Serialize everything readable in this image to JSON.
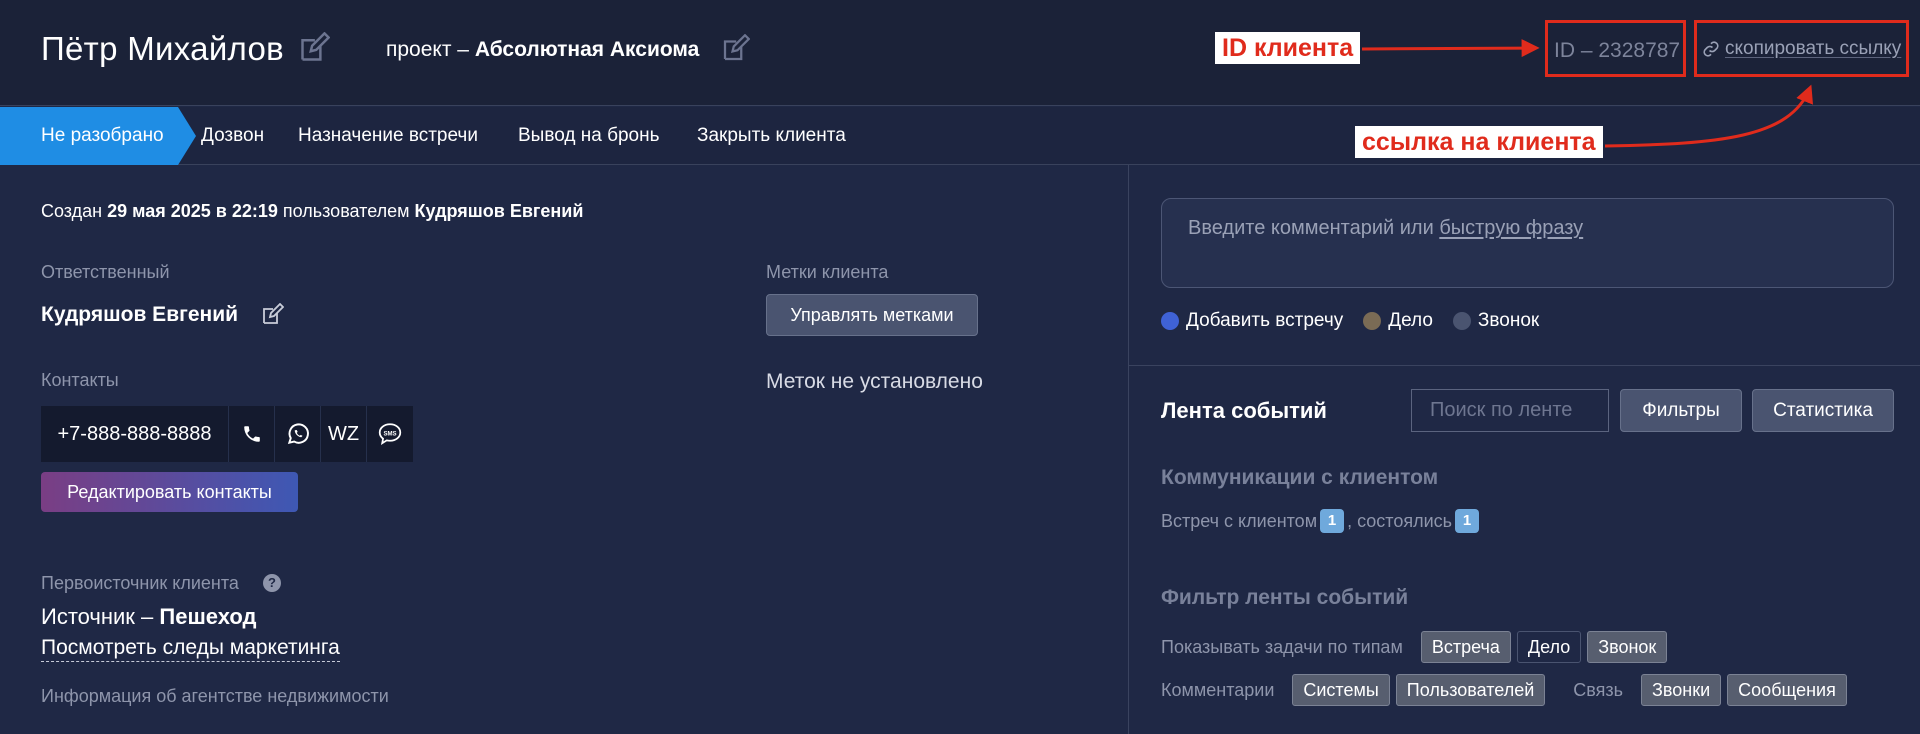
{
  "header": {
    "client_name": "Пётр Михайлов",
    "project_prefix": "проект – ",
    "project_name": "Абсолютная Аксиома",
    "client_id": "ID – 2328787",
    "copy_link": "скопировать ссылку"
  },
  "annotations": {
    "id_label": "ID клиента",
    "link_label": "ссылка на клиента",
    "color": "#e02b1c"
  },
  "tabs": {
    "active": "Не разобрано",
    "items": [
      "Дозвон",
      "Назначение встречи",
      "Вывод на бронь",
      "Закрыть клиента"
    ]
  },
  "left": {
    "created_prefix": "Создан ",
    "created_date": "29 мая 2025 в 22:19",
    "created_mid": " пользователем ",
    "created_user": "Кудряшов Евгений",
    "responsible_label": "Ответственный",
    "responsible_name": "Кудряшов Евгений",
    "contacts_label": "Контакты",
    "phone": "+7-888-888-8888",
    "wz": "WZ",
    "edit_contacts": "Редактировать контакты",
    "source_label": "Первоисточник клиента",
    "source_prefix": "Источник – ",
    "source_value": "Пешеход",
    "marketing_link": "Посмотреть следы маркетинга",
    "agency_info": "Информация об агентстве недвижимости",
    "tags_label": "Метки клиента",
    "manage_tags": "Управлять метками",
    "no_tags": "Меток не установлено"
  },
  "right": {
    "comment_placeholder": "Введите комментарий или ",
    "comment_phrase": "быструю фразу",
    "radios": [
      "Добавить встречу",
      "Дело",
      "Звонок"
    ],
    "radio_colors": [
      "#3f62d6",
      "#7a6b55",
      "#4a5470"
    ],
    "feed_title": "Лента событий",
    "feed_search_placeholder": "Поиск по ленте",
    "filters_btn": "Фильтры",
    "stats_btn": "Статистика",
    "comm_title": "Коммуникации с клиентом",
    "meets_prefix": "Встреч с клиентом",
    "meets_count": "1",
    "meets_mid": ", состоялись",
    "meets_done": "1",
    "filter_title": "Фильтр ленты событий",
    "types_label": "Показывать задачи по типам",
    "types": [
      "Встреча",
      "Дело",
      "Звонок"
    ],
    "comments_label": "Комментарии",
    "comments": [
      "Системы",
      "Пользователей"
    ],
    "link_label": "Связь",
    "links": [
      "Звонки",
      "Сообщения"
    ]
  }
}
